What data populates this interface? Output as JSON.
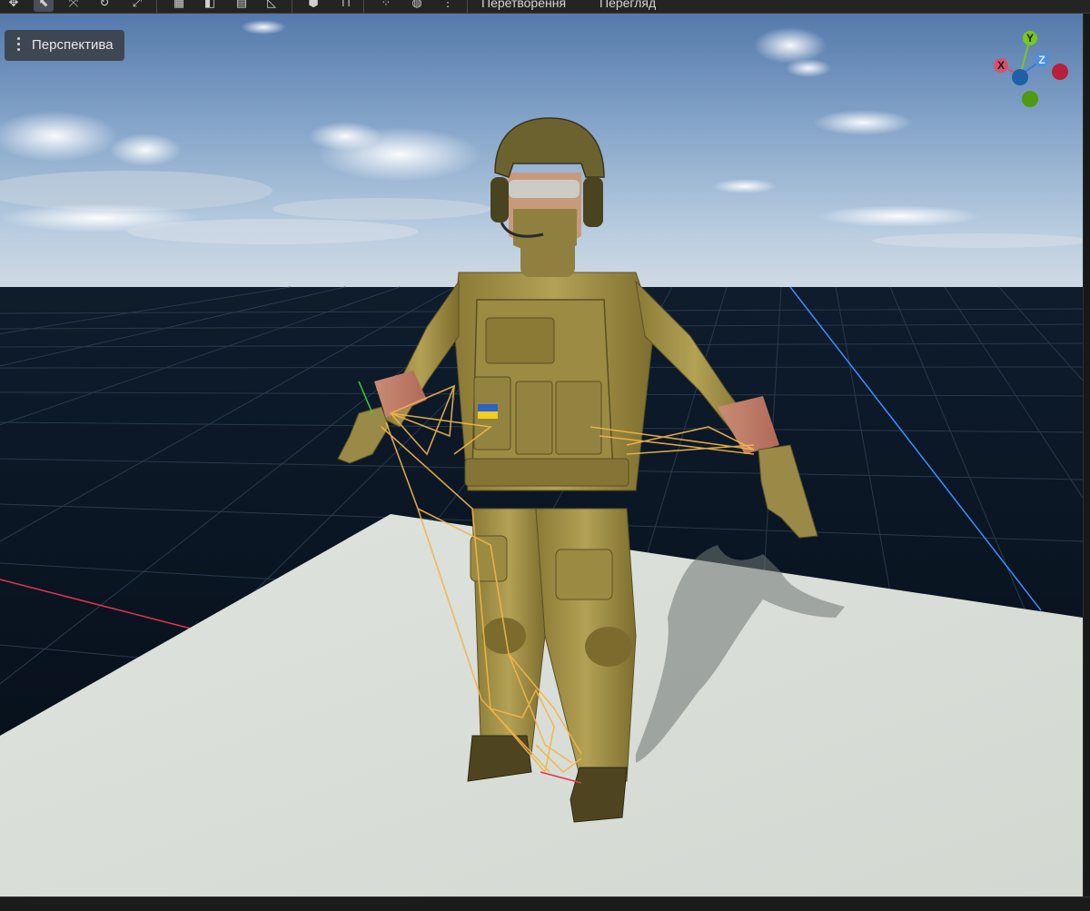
{
  "toolbar": {
    "icons": [
      {
        "name": "transform-icon",
        "glyph": "✥",
        "active": false
      },
      {
        "name": "select-cursor-icon",
        "glyph": "⬉",
        "active": true
      },
      {
        "name": "translate-icon",
        "glyph": "⤧",
        "active": false
      },
      {
        "name": "rotate-icon",
        "glyph": "↻",
        "active": false
      },
      {
        "name": "scale-icon",
        "glyph": "⤢",
        "active": false
      },
      {
        "name": "snap-grid-icon",
        "glyph": "▦",
        "active": false
      },
      {
        "name": "snap-rotation-icon",
        "glyph": "◧",
        "active": false
      },
      {
        "name": "snap-scale-icon",
        "glyph": "▤",
        "active": false
      },
      {
        "name": "angle-icon",
        "glyph": "◺",
        "active": false
      },
      {
        "name": "cube-icon",
        "glyph": "⬢",
        "active": false
      },
      {
        "name": "camera-speed-icon",
        "glyph": "⊓",
        "active": false
      },
      {
        "name": "bone-icon",
        "glyph": "⁘",
        "active": false
      },
      {
        "name": "lit-mode-icon",
        "glyph": "◍",
        "active": false
      },
      {
        "name": "more-options-icon",
        "glyph": "⋮",
        "active": false
      }
    ],
    "menus": [
      "Перетворення",
      "Перегляд"
    ]
  },
  "viewport": {
    "view_mode_label": "Перспектива"
  },
  "gizmo": {
    "y_label": "Y",
    "x_label": "X",
    "z_label": "Z",
    "colors": {
      "x": "#d9506b",
      "y": "#7ac71c",
      "z": "#2f7fd6"
    }
  }
}
